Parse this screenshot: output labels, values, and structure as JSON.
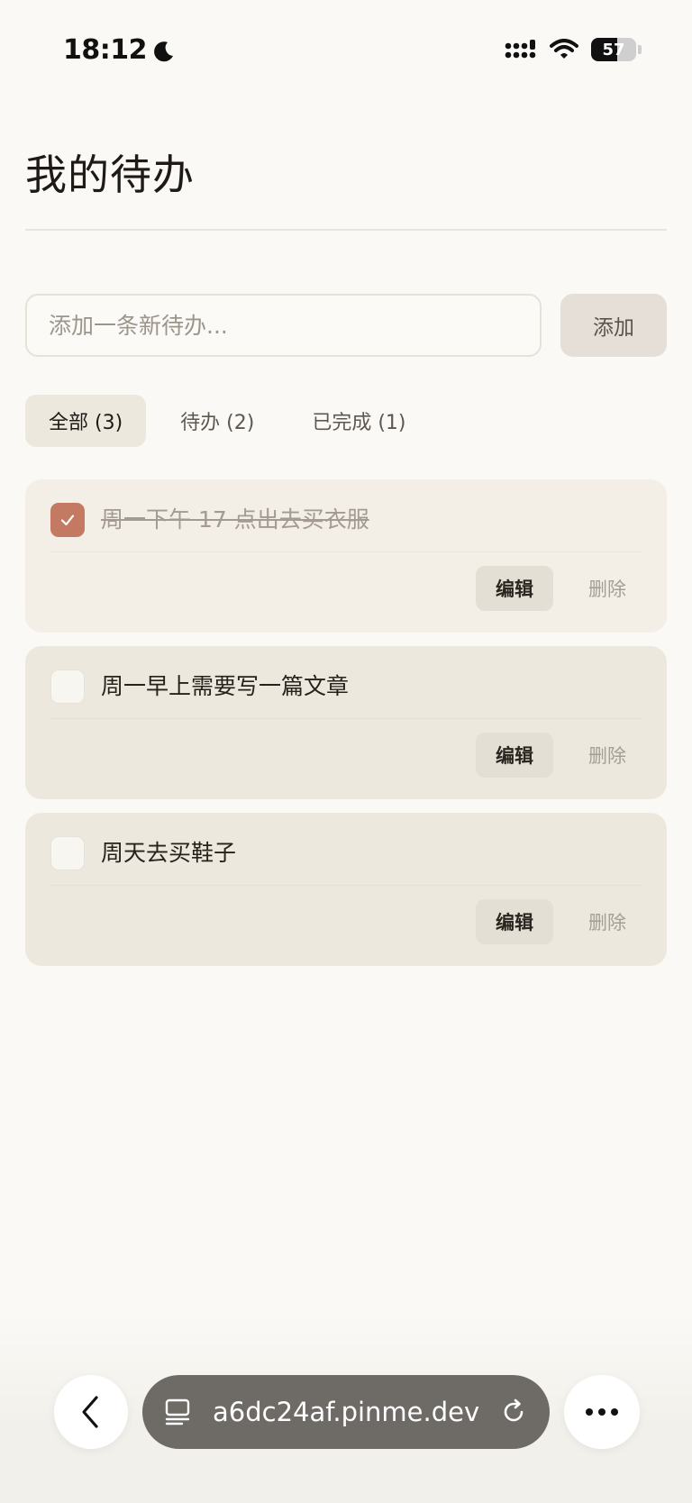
{
  "status_bar": {
    "time": "18:12",
    "battery": "57",
    "battery_level": 0.57,
    "icons": [
      "moon-icon",
      "signal-icon",
      "wifi-icon",
      "battery-icon"
    ]
  },
  "page": {
    "title": "我的待办"
  },
  "add_form": {
    "placeholder": "添加一条新待办...",
    "button_label": "添加"
  },
  "tabs": [
    {
      "label": "全部 (3)",
      "active": true
    },
    {
      "label": "待办 (2)",
      "active": false
    },
    {
      "label": "已完成 (1)",
      "active": false
    }
  ],
  "todos": [
    {
      "text": "周一下午 17 点出去买衣服",
      "done": true,
      "edit_label": "编辑",
      "delete_label": "删除"
    },
    {
      "text": "周一早上需要写一篇文章",
      "done": false,
      "edit_label": "编辑",
      "delete_label": "删除"
    },
    {
      "text": "周天去买鞋子",
      "done": false,
      "edit_label": "编辑",
      "delete_label": "删除"
    }
  ],
  "browser": {
    "url": "a6dc24af.pinme.dev",
    "icons": [
      "back-chevron-icon",
      "tabs-icon",
      "reload-icon",
      "more-dots-icon"
    ]
  },
  "colors": {
    "accent": "#c47a62",
    "background": "#faf9f5",
    "card": "#ece8dd"
  }
}
